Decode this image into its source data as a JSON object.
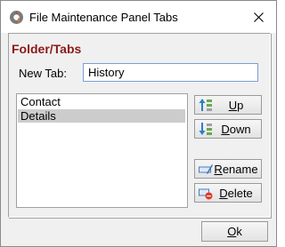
{
  "window": {
    "title": "File Maintenance Panel Tabs",
    "app_icon": "gear-flame-icon",
    "close_icon": "close-icon"
  },
  "section": {
    "heading": "Folder/Tabs",
    "heading_color": "#8b1a1a"
  },
  "new_tab": {
    "label": "New Tab:",
    "value": "History"
  },
  "tabs_list": {
    "items": [
      "Contact",
      "Details"
    ],
    "selected": "Details"
  },
  "buttons": {
    "up": {
      "accel": "U",
      "rest": "p",
      "icon": "move-up-icon"
    },
    "down": {
      "accel": "D",
      "rest": "own",
      "icon": "move-down-icon"
    },
    "rename": {
      "accel": "R",
      "rest": "ename",
      "icon": "rename-icon"
    },
    "delete": {
      "accel": "D",
      "rest": "elete",
      "icon": "delete-icon"
    },
    "ok": {
      "accel": "O",
      "rest": "k"
    }
  }
}
